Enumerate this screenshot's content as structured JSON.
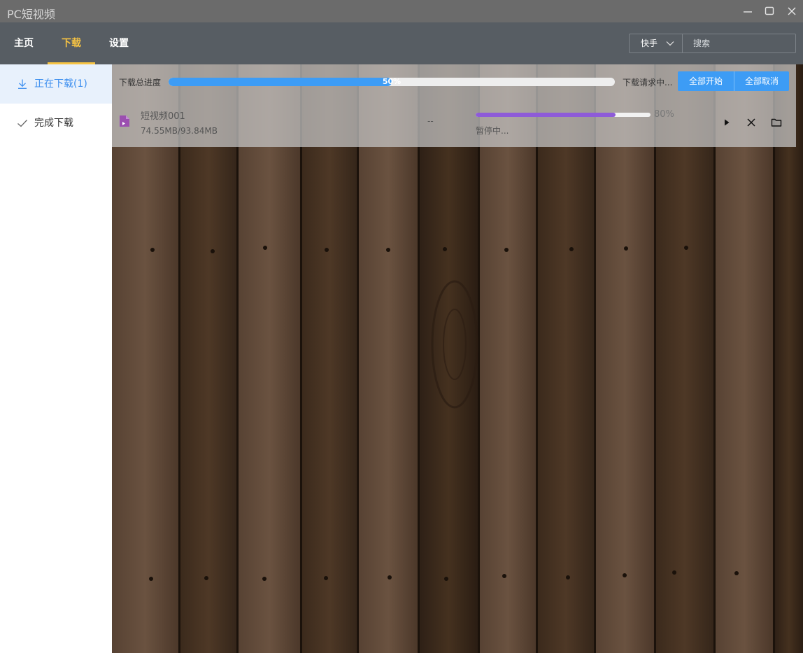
{
  "window": {
    "title": "PC短视频",
    "controls": [
      "minimize-icon",
      "maximize-icon",
      "close-icon"
    ]
  },
  "nav": {
    "tabs": [
      {
        "label": "主页",
        "active": false
      },
      {
        "label": "下载",
        "active": true
      },
      {
        "label": "设置",
        "active": false
      }
    ],
    "platform_select": {
      "value": "快手"
    },
    "search": {
      "value": "",
      "placeholder": "搜索"
    }
  },
  "sidebar": {
    "items": [
      {
        "label": "正在下载(1)",
        "icon": "download-icon",
        "active": true
      },
      {
        "label": "完成下载",
        "icon": "check-icon",
        "active": false
      }
    ]
  },
  "download_panel": {
    "total_label": "下载总进度",
    "total_progress": 50,
    "total_progress_text": "50%",
    "request_status": "下载请求中...",
    "buttons": {
      "start_all": "全部开始",
      "cancel_all": "全部取消"
    },
    "tasks": [
      {
        "name": "短视频001",
        "size": "74.55MB/93.84MB",
        "speed": "--",
        "progress": 80,
        "progress_text": "80%",
        "status": "暂停中...",
        "actions": [
          "play-icon",
          "close-icon",
          "folder-icon"
        ]
      }
    ]
  },
  "colors": {
    "accent_blue": "#3d9cf5",
    "active_tab": "#f6c343",
    "task_progress": "#8e5bd8",
    "navbar": "#575d63",
    "titlebar": "#6b6b6b"
  }
}
